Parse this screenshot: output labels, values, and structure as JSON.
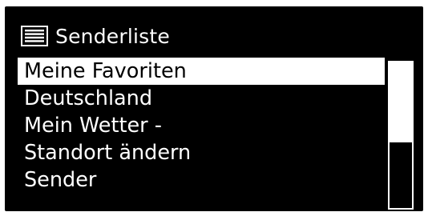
{
  "screen": {
    "title": "Senderliste",
    "title_icon": "list-icon"
  },
  "list": {
    "items": [
      {
        "label": "Meine Favoriten",
        "selected": true
      },
      {
        "label": "Deutschland",
        "selected": false
      },
      {
        "label": "Mein Wetter -",
        "selected": false
      },
      {
        "label": "Standort ändern",
        "selected": false
      },
      {
        "label": "Sender",
        "selected": false
      }
    ]
  },
  "scrollbar": {
    "thumb_position_fraction": 0.55,
    "thumb_size_fraction": 0.45
  },
  "colors": {
    "background": "#000000",
    "foreground": "#ffffff",
    "selection_bg": "#ffffff",
    "selection_fg": "#000000"
  }
}
